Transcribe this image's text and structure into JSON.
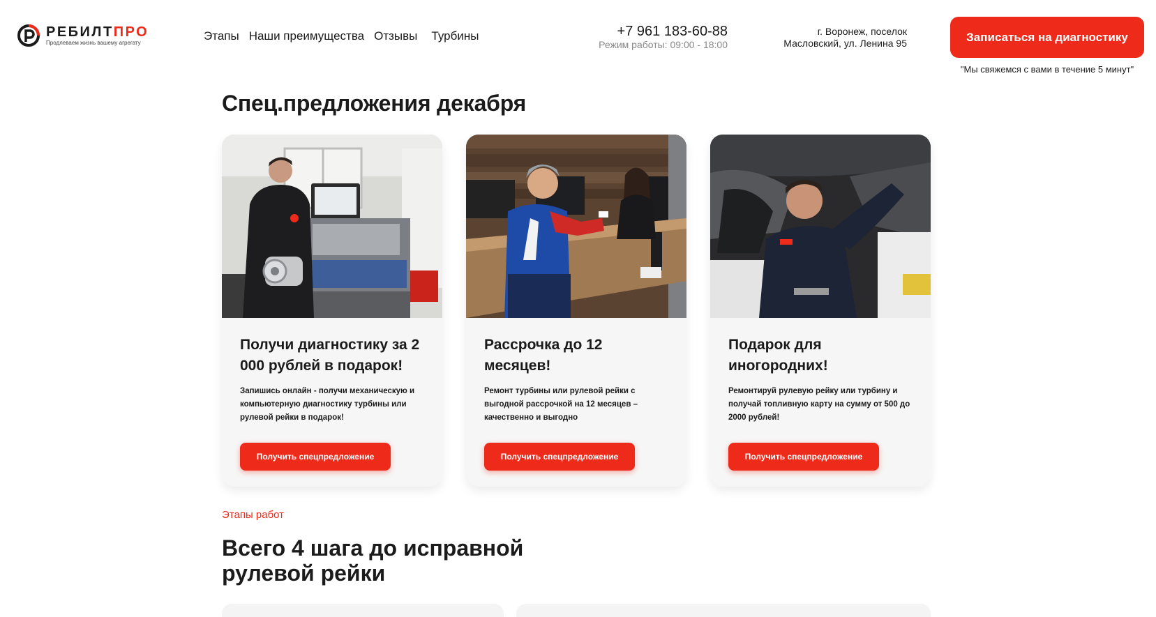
{
  "header": {
    "logo": {
      "name_part1": "РЕБИЛТ",
      "name_part2": "ПРО",
      "tagline": "Продлеваем жизнь вашему агрегату"
    },
    "nav": [
      "Этапы",
      "Наши преимущества",
      "Отзывы",
      "Турбины"
    ],
    "phone": "+7 961 183-60-88",
    "hours": "Режим работы: 09:00 - 18:00",
    "address_line1": "г. Воронеж, поселок",
    "address_line2": "Масловский, ул. Ленина 95",
    "cta_label": "Записаться на диагностику",
    "cta_note": "\"Мы свяжемся с вами в течение 5 минут\""
  },
  "offers": {
    "title": "Спец.предложения декабря",
    "cards": [
      {
        "title": "Получи диагностику за 2 000 рублей в подарок!",
        "text": "Запишись онлайн - получи механическую и компьютерную диагностику турбины или рулевой рейки в подарок!",
        "button": "Получить спецпредложение"
      },
      {
        "title": "Рассрочка до 12 месяцев!",
        "text": "Ремонт турбины или рулевой рейки с выгодной рассрочкой на 12 месяцев – качественно и выгодно",
        "button": "Получить спецпредложение"
      },
      {
        "title": "Подарок для иногородних!",
        "text": "Ремонтируй рулевую рейку или турбину и получай топливную карту на сумму от 500 до 2000 рублей!",
        "button": "Получить спецпредложение"
      }
    ]
  },
  "stages": {
    "label": "Этапы работ",
    "title": "Всего 4 шага до исправной рулевой рейки"
  },
  "colors": {
    "accent": "#ee2a1b",
    "text": "#1b1b1b",
    "card_bg": "#f6f6f6"
  }
}
